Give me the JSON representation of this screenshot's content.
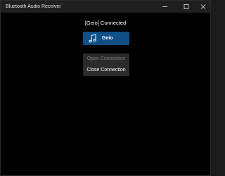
{
  "window": {
    "title": "Bluetooth Audio Receiver",
    "controls": {
      "minimize_icon": "minimize-icon",
      "maximize_icon": "maximize-icon",
      "close_icon": "close-icon"
    }
  },
  "main": {
    "status_text": "[Geio] Connected",
    "device_button": {
      "label": "Geio",
      "icon": "music-note-icon",
      "color": "#0f4f88"
    },
    "menu": {
      "items": [
        {
          "label": "Open Connection",
          "enabled": false
        },
        {
          "label": "Close Connection",
          "enabled": true
        }
      ]
    }
  }
}
